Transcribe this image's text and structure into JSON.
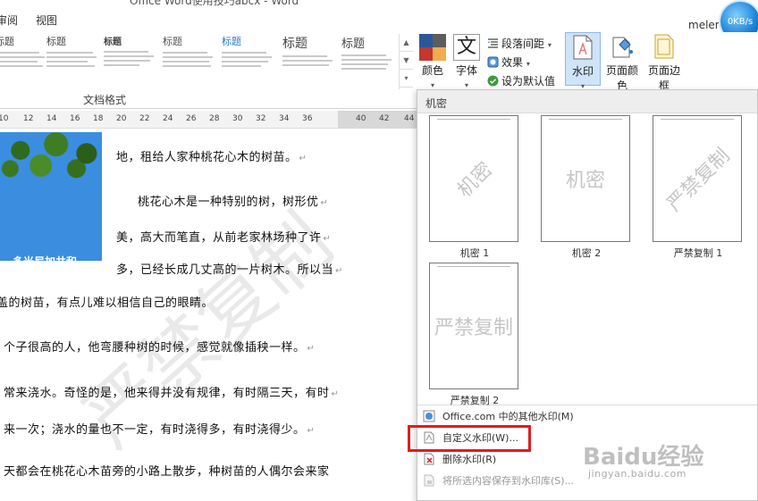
{
  "window": {
    "title": "Office Word使用技巧abcx - Word",
    "user": "meler",
    "network_speed": "0KB/s"
  },
  "menu": {
    "tabs": [
      "审阅",
      "视图"
    ]
  },
  "ribbon": {
    "style_gallery": {
      "items": [
        "标题",
        "标题",
        "标题",
        "标题",
        "标题",
        "标题",
        "标题"
      ],
      "scroll_up": "▲",
      "scroll_down": "▼",
      "expand": "▾"
    },
    "doc_format_group_label": "文档格式",
    "colors_label": "颜色",
    "fonts_label": "字体",
    "font_glyph": "文",
    "paragraph_spacing_label": "段落间距",
    "effects_label": "效果",
    "set_default_label": "设为默认值",
    "watermark_label": "水印",
    "page_color_label": "页面颜色",
    "page_borders_label": "页面边框",
    "caret": "▾",
    "accent_color": "#2b579a"
  },
  "ruler": {
    "ticks": [
      "10",
      "12",
      "14",
      "16",
      "18",
      "20",
      "22",
      "24",
      "26",
      "28",
      "30",
      "32",
      "34",
      "36",
      "40",
      "42",
      "44"
    ]
  },
  "document": {
    "image_caption": "多米尼加共和",
    "watermark_text": "严禁复制",
    "lines": [
      "地，租给人家种桃花心木的树苗。",
      "桃花心木是一种特别的树，树形优",
      "美，高大而笔直，从前老家林场种了许",
      "多，已经长成几丈高的一片树木。所以当",
      "盖的树苗，有点儿难以相信自己的眼睛。",
      "个子很高的人，他弯腰种树的时候，感觉就像插秧一样。",
      "常来浇水。奇怪的是，他来得并没有规律，有时隔三天，有时",
      "来一次；浇水的量也不一定，有时浇得多，有时浇得少。",
      "天都会在桃花心木苗旁的小路上散步，种树苗的人偶尔会来家"
    ],
    "para_mark": "↵"
  },
  "watermark_panel": {
    "section_title": "机密",
    "items": [
      {
        "label": "机密 1",
        "text": "机密",
        "style": "diagonal"
      },
      {
        "label": "机密 2",
        "text": "机密",
        "style": "horizontal"
      },
      {
        "label": "严禁复制 1",
        "text": "严禁复制",
        "style": "diagonal"
      },
      {
        "label": "严禁复制 2",
        "text": "严禁复制",
        "style": "horizontal"
      }
    ],
    "menu": {
      "more_from_office": "Office.com 中的其他水印(M)",
      "custom_watermark": "自定义水印(W)...",
      "remove_watermark": "删除水印(R)",
      "save_selection": "将所选内容保存到水印库(S)..."
    },
    "highlight_color": "#e31b1b"
  },
  "site_watermark": {
    "logo": "Baidu经验",
    "url": "jingyan.baidu.com"
  }
}
